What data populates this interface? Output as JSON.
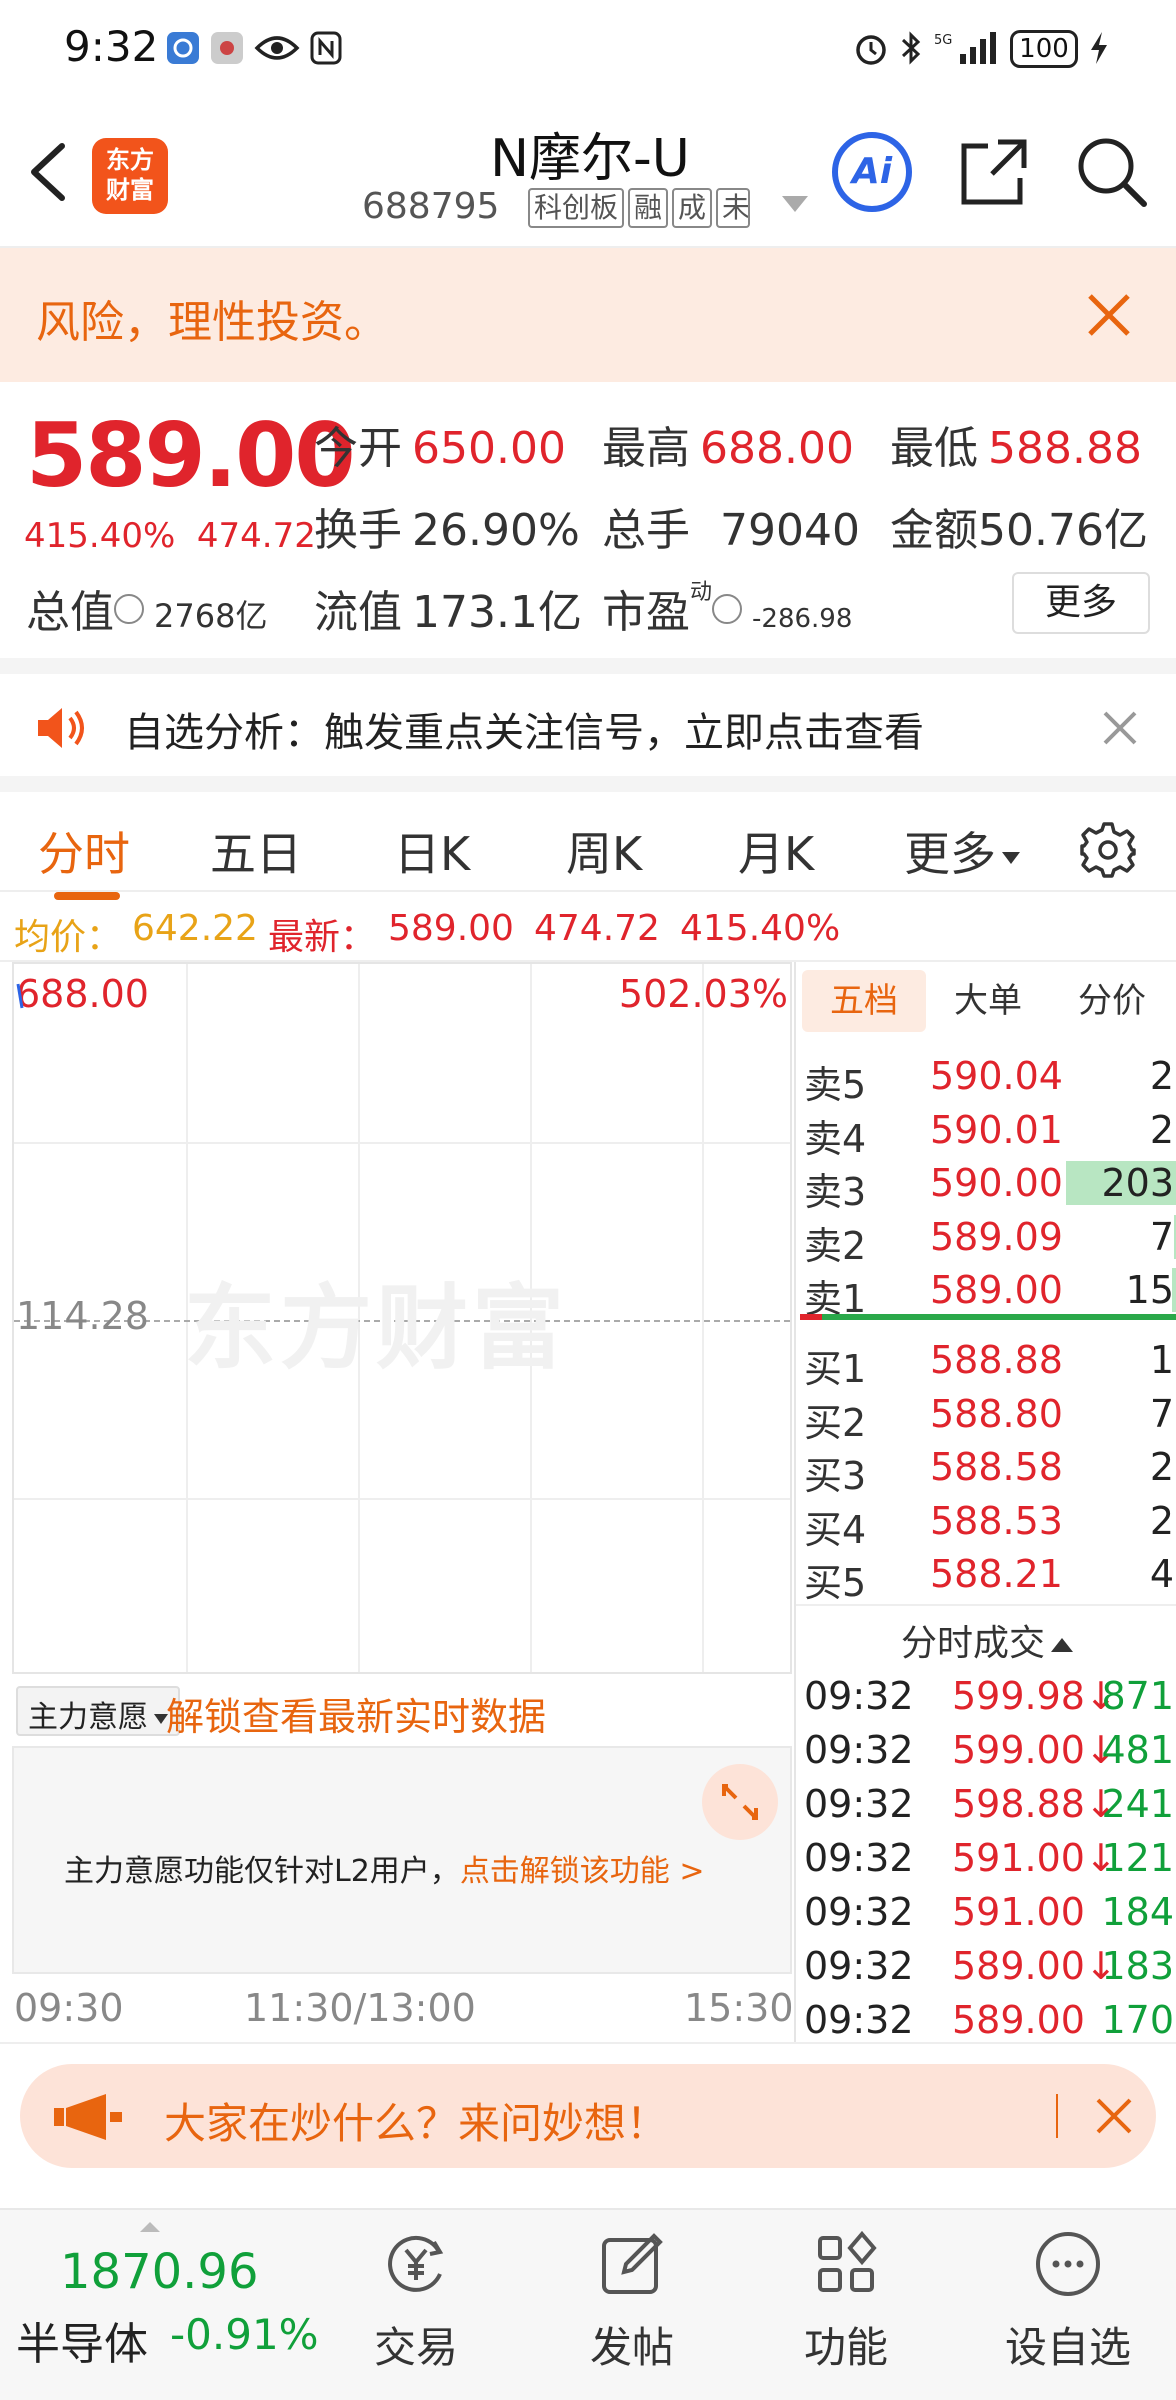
{
  "status_bar": {
    "time": "9:32",
    "battery": "100"
  },
  "header": {
    "logo_line1": "东方",
    "logo_line2": "财富",
    "title": "N摩尔-U",
    "code": "688795",
    "tags": [
      "科创板",
      "融",
      "成",
      "未"
    ],
    "ai_label": "Ai"
  },
  "risk_banner": {
    "text": "风险，理性投资。"
  },
  "quote": {
    "price": "589.00",
    "change_pct": "415.40%",
    "change": "474.72",
    "open_label": "今开",
    "open": "650.00",
    "high_label": "最高",
    "high": "688.00",
    "low_label": "最低",
    "low": "588.88",
    "turnover_label": "换手",
    "turnover": "26.90%",
    "volume_label": "总手",
    "volume": "79040",
    "amount_label": "金额",
    "amount": "50.76亿",
    "mktcap_label": "总值",
    "mktcap": "2768亿",
    "float_label": "流值",
    "float": "173.1亿",
    "pe_label": "市盈",
    "pe_sup": "动",
    "pe": "-286.98",
    "more_label": "更多"
  },
  "analysis": {
    "text": "自选分析：触发重点关注信号，立即点击查看"
  },
  "tabs": [
    "分时",
    "五日",
    "日K",
    "周K",
    "月K",
    "更多"
  ],
  "infoline": {
    "avg_label": "均价：",
    "avg": "642.22",
    "latest_label": "最新：",
    "latest": "589.00",
    "change": "474.72",
    "change_pct": "415.40%"
  },
  "chart": {
    "top_price": "688.00",
    "top_pct": "502.03%",
    "mid_price": "114.28",
    "watermark": "东方财富"
  },
  "main_force": {
    "select_label": "主力意愿",
    "unlock_text": "解锁查看最新实时数据",
    "notice": "主力意愿功能仅针对L2用户，",
    "notice_link": "点击解锁该功能 >"
  },
  "time_axis": [
    "09:30",
    "11:30/13:00",
    "15:30"
  ],
  "book": {
    "tabs": [
      "五档",
      "大单",
      "分价"
    ],
    "asks": [
      {
        "label": "卖5",
        "price": "590.04",
        "vol": "2",
        "bar": 0
      },
      {
        "label": "卖4",
        "price": "590.01",
        "vol": "2",
        "bar": 0
      },
      {
        "label": "卖3",
        "price": "590.00",
        "vol": "203",
        "bar": 1
      },
      {
        "label": "卖2",
        "price": "589.09",
        "vol": "7",
        "bar": 0.03
      },
      {
        "label": "卖1",
        "price": "589.00",
        "vol": "15",
        "bar": 0.05
      }
    ],
    "bids": [
      {
        "label": "买1",
        "price": "588.88",
        "vol": "1"
      },
      {
        "label": "买2",
        "price": "588.80",
        "vol": "7"
      },
      {
        "label": "买3",
        "price": "588.58",
        "vol": "2"
      },
      {
        "label": "买4",
        "price": "588.53",
        "vol": "2"
      },
      {
        "label": "买5",
        "price": "588.21",
        "vol": "4"
      }
    ],
    "trades_title": "分时成交",
    "trades": [
      {
        "time": "09:32",
        "price": "599.98↓",
        "vol": "871"
      },
      {
        "time": "09:32",
        "price": "599.00↓",
        "vol": "481"
      },
      {
        "time": "09:32",
        "price": "598.88↓",
        "vol": "241"
      },
      {
        "time": "09:32",
        "price": "591.00↓",
        "vol": "121"
      },
      {
        "time": "09:32",
        "price": "591.00",
        "vol": "184"
      },
      {
        "time": "09:32",
        "price": "589.00↓",
        "vol": "183"
      },
      {
        "time": "09:32",
        "price": "589.00",
        "vol": "170"
      }
    ]
  },
  "ask_banner": {
    "text": "大家在炒什么？来问妙想！"
  },
  "bottom_nav": {
    "index_value": "1870.96",
    "index_name": "半导体",
    "index_pct": "-0.91%",
    "items": [
      "交易",
      "发帖",
      "功能",
      "设自选"
    ]
  }
}
